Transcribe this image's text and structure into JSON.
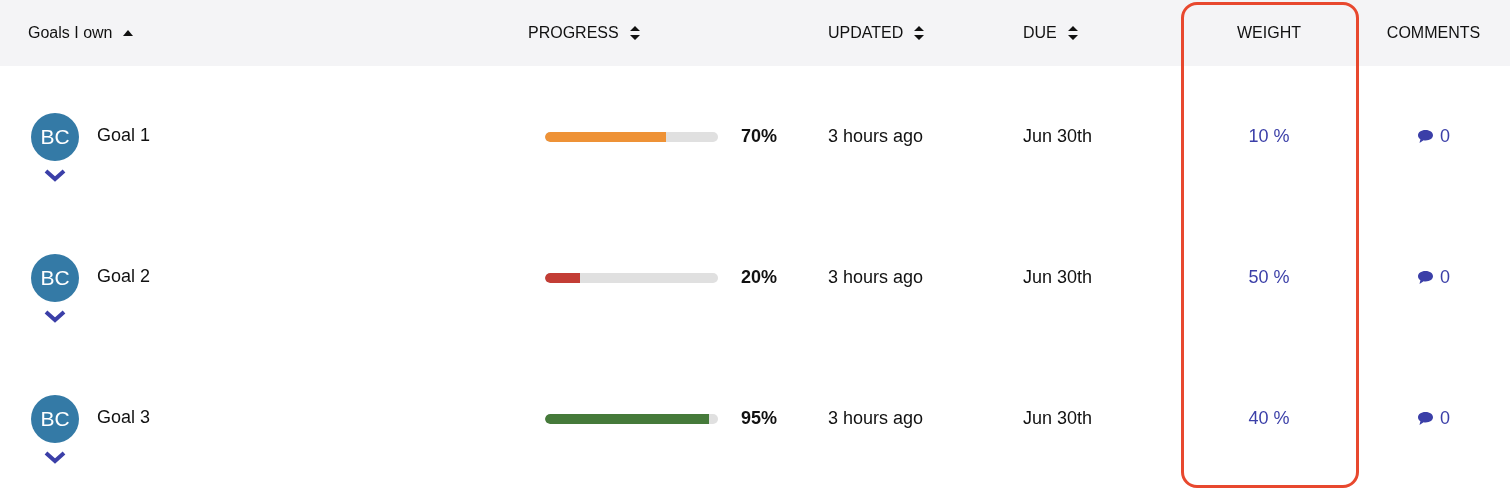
{
  "columns": [
    {
      "label": "Goals I own",
      "sortable": true,
      "sorted": true
    },
    {
      "label": "PROGRESS",
      "sortable": true,
      "sorted": false
    },
    {
      "label": "UPDATED",
      "sortable": true,
      "sorted": false
    },
    {
      "label": "DUE",
      "sortable": true,
      "sorted": false
    },
    {
      "label": "WEIGHT",
      "sortable": false
    },
    {
      "label": "COMMENTS",
      "sortable": false
    }
  ],
  "rows": [
    {
      "initials": "BC",
      "name": "Goal 1",
      "level": 0.7,
      "color": "#ee9236",
      "percent": "70%",
      "updated": "3 hours ago",
      "due": "Jun 30th",
      "weight": "10 %",
      "comments": "0"
    },
    {
      "initials": "BC",
      "name": "Goal 2",
      "level": 0.2,
      "color": "#c33d35",
      "percent": "20%",
      "updated": "3 hours ago",
      "due": "Jun 30th",
      "weight": "50 %",
      "comments": "0"
    },
    {
      "initials": "BC",
      "name": "Goal 3",
      "level": 0.95,
      "color": "#457a3a",
      "percent": "95%",
      "updated": "3 hours ago",
      "due": "Jun 30th",
      "weight": "40 %",
      "comments": "0"
    }
  ]
}
